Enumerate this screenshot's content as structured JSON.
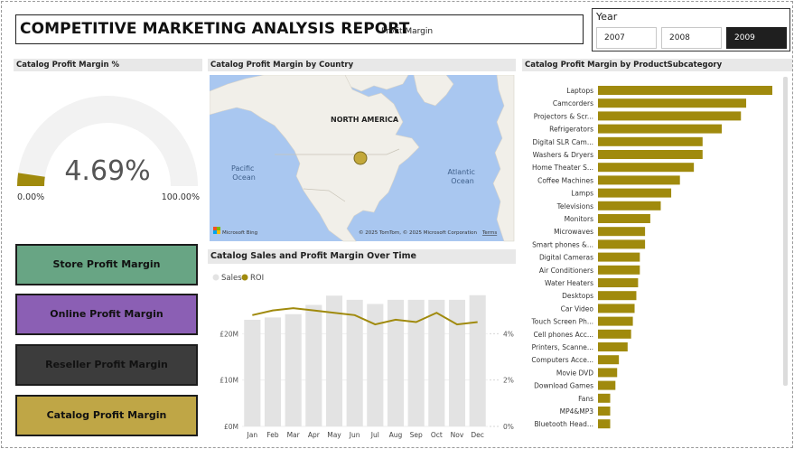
{
  "header": {
    "title": "COMPETITIVE MARKETING ANALYSIS REPORT",
    "subtitle": "Profit Margin"
  },
  "year_slicer": {
    "label": "Year",
    "options": [
      "2007",
      "2008",
      "2009"
    ],
    "selected": "2009"
  },
  "gauge": {
    "title": "Catalog Profit Margin %",
    "value_label": "4.69%",
    "min_label": "0.00%",
    "max_label": "100.00%",
    "value": 4.69,
    "min": 0,
    "max": 100,
    "colors": {
      "fill": "#a08a0d",
      "track": "#f2f2f2"
    }
  },
  "map": {
    "title": "Catalog Profit Margin by Country",
    "continent_label": "NORTH AMERICA",
    "ocean_pacific": "Pacific Ocean",
    "ocean_atlantic": "Atlantic Ocean",
    "attribution": "© 2025 TomTom, © 2025 Microsoft Corporation",
    "terms": "Terms",
    "provider": "Microsoft Bing",
    "colors": {
      "water": "#a9c7f0",
      "land": "#f1efe9",
      "bubble": "#c3a83a"
    }
  },
  "buttons": [
    {
      "label": "Store Profit Margin",
      "color": "#68a584"
    },
    {
      "label": "Online Profit Margin",
      "color": "#8b5fb4"
    },
    {
      "label": "Reseller Profit Margin",
      "color": "#3c3c3c"
    },
    {
      "label": "Catalog Profit Margin",
      "color": "#bfa646"
    }
  ],
  "subcategory_chart": {
    "title": "Catalog Profit Margin by ProductSubcategory",
    "bar_color": "#a08a0d",
    "categories": [
      "Laptops",
      "Camcorders",
      "Projectors & Scr...",
      "Refrigerators",
      "Digital SLR Cam...",
      "Washers & Dryers",
      "Home Theater S...",
      "Coffee Machines",
      "Lamps",
      "Televisions",
      "Monitors",
      "Microwaves",
      "Smart phones &...",
      "Digital Cameras",
      "Air Conditioners",
      "Water Heaters",
      "Desktops",
      "Car Video",
      "Touch Screen Ph...",
      "Cell phones Acc...",
      "Printers, Scanne...",
      "Computers Acce...",
      "Movie DVD",
      "Download Games",
      "Fans",
      "MP4&MP3",
      "Bluetooth Head..."
    ],
    "values": [
      100,
      85,
      82,
      71,
      60,
      60,
      55,
      47,
      42,
      36,
      30,
      27,
      27,
      24,
      24,
      23,
      22,
      21,
      20,
      19,
      17,
      12,
      11,
      10,
      7,
      7,
      7
    ]
  },
  "line_chart": {
    "title": "Catalog Sales and Profit Margin Over Time",
    "legend": [
      {
        "name": "Sales",
        "color": "#e3e3e3"
      },
      {
        "name": "ROI",
        "color": "#a08a0d"
      }
    ],
    "months": [
      "Jan",
      "Feb",
      "Mar",
      "Apr",
      "May",
      "Jun",
      "Jul",
      "Aug",
      "Sep",
      "Oct",
      "Nov",
      "Dec"
    ],
    "sales_ticks": [
      "£0M",
      "£10M",
      "£20M"
    ],
    "roi_ticks": [
      "0%",
      "2%",
      "4%"
    ],
    "sales": [
      23,
      23.5,
      24.2,
      26.2,
      28.2,
      27.3,
      26.4,
      27.3,
      27.3,
      27.3,
      27.3,
      28.3
    ],
    "roi": [
      4.8,
      5.0,
      5.1,
      5.0,
      4.9,
      4.8,
      4.4,
      4.6,
      4.5,
      4.9,
      4.4,
      4.5
    ],
    "sales_max": 30,
    "roi_max": 6
  }
}
